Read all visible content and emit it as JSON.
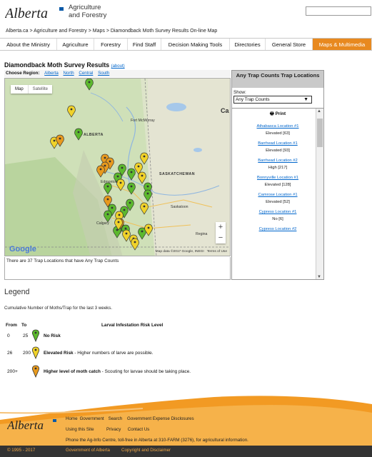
{
  "header": {
    "logo_text": "Alberta",
    "ministry_line1": "Agriculture",
    "ministry_line2": "and Forestry",
    "search_value": ""
  },
  "breadcrumb": "Alberta.ca > Agriculture and Forestry > Maps > Diamondback Moth Survey Results On-line Map",
  "nav": {
    "items": [
      "About the Ministry",
      "Agriculture",
      "Forestry",
      "Find Staff",
      "Decision Making Tools",
      "Directories",
      "General Store",
      "Maps & Multimedia"
    ]
  },
  "map_section": {
    "title": "Diamondback Moth Survey Results",
    "about_link": "(about)",
    "region_label": "Choose Region:",
    "regions": [
      "Alberta",
      "North",
      "Central",
      "South"
    ],
    "map_button": "Map",
    "satellite_button": "Satellite",
    "zoom_in": "+",
    "zoom_out": "−",
    "google_logo": "Google",
    "map_attribution": "Map data ©2017 Google, INEGI",
    "terms": "Terms of Use",
    "place_labels": [
      "Fort McMurray",
      "ALBERTA",
      "SASKATCHEWAN",
      "Saskatoon",
      "Regina",
      "Calgary",
      "Edmonton",
      "Ca"
    ],
    "status_text": "There are 37 Trap Locations that have Any Trap Counts"
  },
  "panel": {
    "title": "Any Trap Counts Trap Locations",
    "show_label": "Show:",
    "show_selected": "Any Trap Counts",
    "print_label": "Print",
    "locations": [
      {
        "name": "Athabasca Location #1",
        "status": "Elevated [63]"
      },
      {
        "name": "Barrhead Location #1",
        "status": "Elevated [93]"
      },
      {
        "name": "Barrhead Location #2",
        "status": "High [217]"
      },
      {
        "name": "Bonnyville Location #1",
        "status": "Elevated [128]"
      },
      {
        "name": "Camrose Location #1",
        "status": "Elevated [52]"
      },
      {
        "name": "Cypress Location #1",
        "status": "No [6]"
      },
      {
        "name": "Cypress Location #2",
        "status": ""
      }
    ]
  },
  "legend": {
    "title": "Legend",
    "subtitle": "Cumulative Number of Moths/Trap for the last 3 weeks.",
    "col_from": "From",
    "col_to": "To",
    "col_risk": "Larval Infestation Risk Level",
    "rows": [
      {
        "from": "0",
        "to": "25",
        "bold": "No Risk",
        "rest": "",
        "color": "#5cb82e"
      },
      {
        "from": "26",
        "to": "200",
        "bold": "Elevated Risk",
        "rest": " - Higher numbers of larve are possible.",
        "color": "#f0d22a"
      },
      {
        "from": "200+",
        "to": "",
        "bold": "Higher level of moth catch",
        "rest": " - Scouting for larvae should be taking place.",
        "color": "#e89a1e"
      }
    ]
  },
  "footer": {
    "logo_text": "Alberta",
    "links_row1": [
      "Home",
      "Government",
      "Search",
      "Government Expense Disclosures"
    ],
    "links_row2": [
      "Using this Site",
      "Privacy",
      "Contact Us"
    ],
    "phone": "Phone the Ag-Info Centre, toll-free in Alberta at 310-FARM (3276), for agricultural information.",
    "copyright": "© 1995 - 2017",
    "gov": "Government of Alberta",
    "disclaimer": "Copyright and Disclaimer"
  },
  "colors": {
    "accent_orange": "#e8891f",
    "link_blue": "#0066cc",
    "pin_green": "#5cb82e",
    "pin_yellow": "#f0d22a",
    "pin_orange": "#e89a1e"
  },
  "map_pins": [
    "green",
    "yellow",
    "green",
    "yellow",
    "orange",
    "orange",
    "orange",
    "yellow",
    "orange",
    "green",
    "yellow",
    "green",
    "yellow",
    "green",
    "green",
    "yellow",
    "green",
    "green",
    "orange",
    "green",
    "green",
    "yellow",
    "green",
    "green",
    "yellow",
    "green",
    "green",
    "yellow",
    "yellow",
    "orange",
    "yellow",
    "green",
    "yellow",
    "green",
    "green",
    "yellow",
    "orange"
  ]
}
